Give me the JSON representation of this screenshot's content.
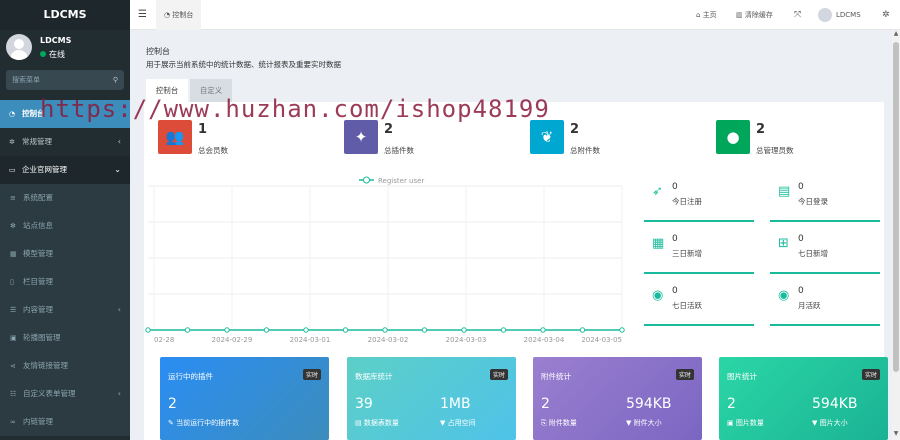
{
  "sidebar": {
    "logo": "LDCMS",
    "user": {
      "name": "LDCMS",
      "status": "在线"
    },
    "search_placeholder": "搜索菜单",
    "items": [
      {
        "label": "控制台",
        "icon": "dashboard-icon",
        "active": true
      },
      {
        "label": "常规管理",
        "icon": "cogs-icon"
      },
      {
        "label": "企业官网管理",
        "icon": "laptop-icon",
        "open": true
      },
      {
        "label": "系统配置",
        "icon": "sliders-icon",
        "sub": true
      },
      {
        "label": "站点信息",
        "icon": "gear-icon",
        "sub": true
      },
      {
        "label": "模型管理",
        "icon": "th-icon",
        "sub": true
      },
      {
        "label": "栏目管理",
        "icon": "file-icon",
        "sub": true
      },
      {
        "label": "内容管理",
        "icon": "list-icon",
        "sub": true
      },
      {
        "label": "轮播图管理",
        "icon": "image-icon",
        "sub": true
      },
      {
        "label": "友情链接管理",
        "icon": "share-icon",
        "sub": true
      },
      {
        "label": "自定义表单管理",
        "icon": "table-icon",
        "sub": true
      },
      {
        "label": "内链管理",
        "icon": "link-icon",
        "sub": true
      }
    ]
  },
  "topbar": {
    "menu_icon": "bars-icon",
    "tab_label": "控制台",
    "home_label": "主页",
    "clear_cache_label": "清除缓存",
    "user_name": "LDCMS"
  },
  "header": {
    "title": "控制台",
    "description": "用于展示当前系统中的统计数据、统计报表及重要实时数据",
    "tabs": [
      "控制台",
      "自定义"
    ]
  },
  "stats": [
    {
      "value": "1",
      "label": "总会员数",
      "icon": "users-icon",
      "color": "#dd4b39"
    },
    {
      "value": "2",
      "label": "总插件数",
      "icon": "magic-icon",
      "color": "#605ca8"
    },
    {
      "value": "2",
      "label": "总附件数",
      "icon": "leaf-icon",
      "color": "#00a7d0"
    },
    {
      "value": "2",
      "label": "总管理员数",
      "icon": "user-icon",
      "color": "#00a65a"
    }
  ],
  "chart_data": {
    "type": "line",
    "legend": [
      "Register user"
    ],
    "x": [
      "02-28",
      "2024-02-29",
      "2024-03-01",
      "2024-03-02",
      "2024-03-03",
      "2024-03-04",
      "2024-03-05"
    ],
    "series": [
      {
        "name": "Register user",
        "values": [
          0,
          0,
          0,
          0,
          0,
          0,
          0,
          0,
          0,
          0,
          0,
          0,
          0
        ]
      }
    ],
    "color": "#18bc9c"
  },
  "mini_stats": [
    {
      "value": "0",
      "label": "今日注册",
      "icon": "rocket-icon"
    },
    {
      "value": "0",
      "label": "今日登录",
      "icon": "vcard-icon"
    },
    {
      "value": "0",
      "label": "三日新增",
      "icon": "calendar-icon"
    },
    {
      "value": "0",
      "label": "七日新增",
      "icon": "calendar-plus-icon"
    },
    {
      "value": "0",
      "label": "七日活跃",
      "icon": "user-circle-icon"
    },
    {
      "value": "0",
      "label": "月活跃",
      "icon": "user-circle-icon"
    }
  ],
  "cards": [
    {
      "title": "运行中的插件",
      "badge": "实时",
      "v1": "2",
      "l1": "当前运行中的插件数",
      "v2": "",
      "l2": "",
      "from": "#2a8df3",
      "to": "#3c8dbc"
    },
    {
      "title": "数据库统计",
      "badge": "实时",
      "v1": "39",
      "l1": "数据表数量",
      "v2": "1MB",
      "l2": "占用空间",
      "from": "#5ccfc7",
      "to": "#4fc3e8"
    },
    {
      "title": "附件统计",
      "badge": "实时",
      "v1": "2",
      "l1": "附件数量",
      "v2": "594KB",
      "l2": "附件大小",
      "from": "#9b7fd0",
      "to": "#7a66c2"
    },
    {
      "title": "图片统计",
      "badge": "实时",
      "v1": "2",
      "l1": "图片数量",
      "v2": "594KB",
      "l2": "图片大小",
      "from": "#2bd6a6",
      "to": "#1ab394"
    }
  ],
  "watermark": "https://www.huzhan.com/ishop48199"
}
